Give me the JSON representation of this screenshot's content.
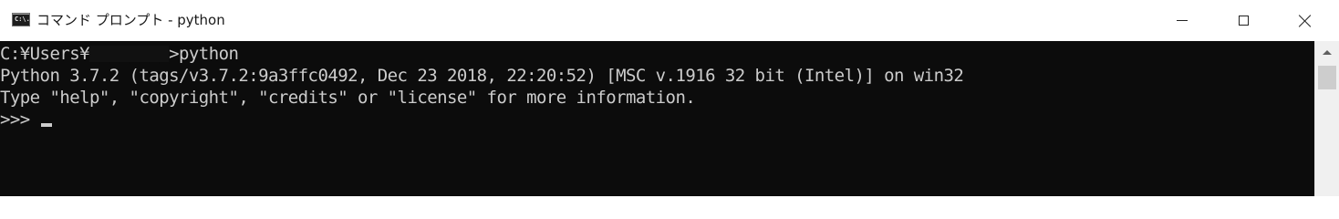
{
  "window": {
    "title": "コマンド プロンプト - python",
    "icon": "cmd-icon",
    "icon_text": "C:\\.",
    "controls": {
      "minimize": "minimize-icon",
      "maximize": "maximize-icon",
      "close": "close-icon"
    }
  },
  "console": {
    "background": "#0c0c0c",
    "foreground": "#cccccc",
    "line1": {
      "prefix": "C:¥Users¥",
      "redacted": "________",
      "suffix": ">python"
    },
    "line2": "Python 3.7.2 (tags/v3.7.2:9a3ffc0492, Dec 23 2018, 22:20:52) [MSC v.1916 32 bit (Intel)] on win32",
    "line3": "Type \"help\", \"copyright\", \"credits\" or \"license\" for more information.",
    "prompt": ">>>"
  },
  "scrollbar": {
    "up_arrow": "arrow-up-icon"
  }
}
